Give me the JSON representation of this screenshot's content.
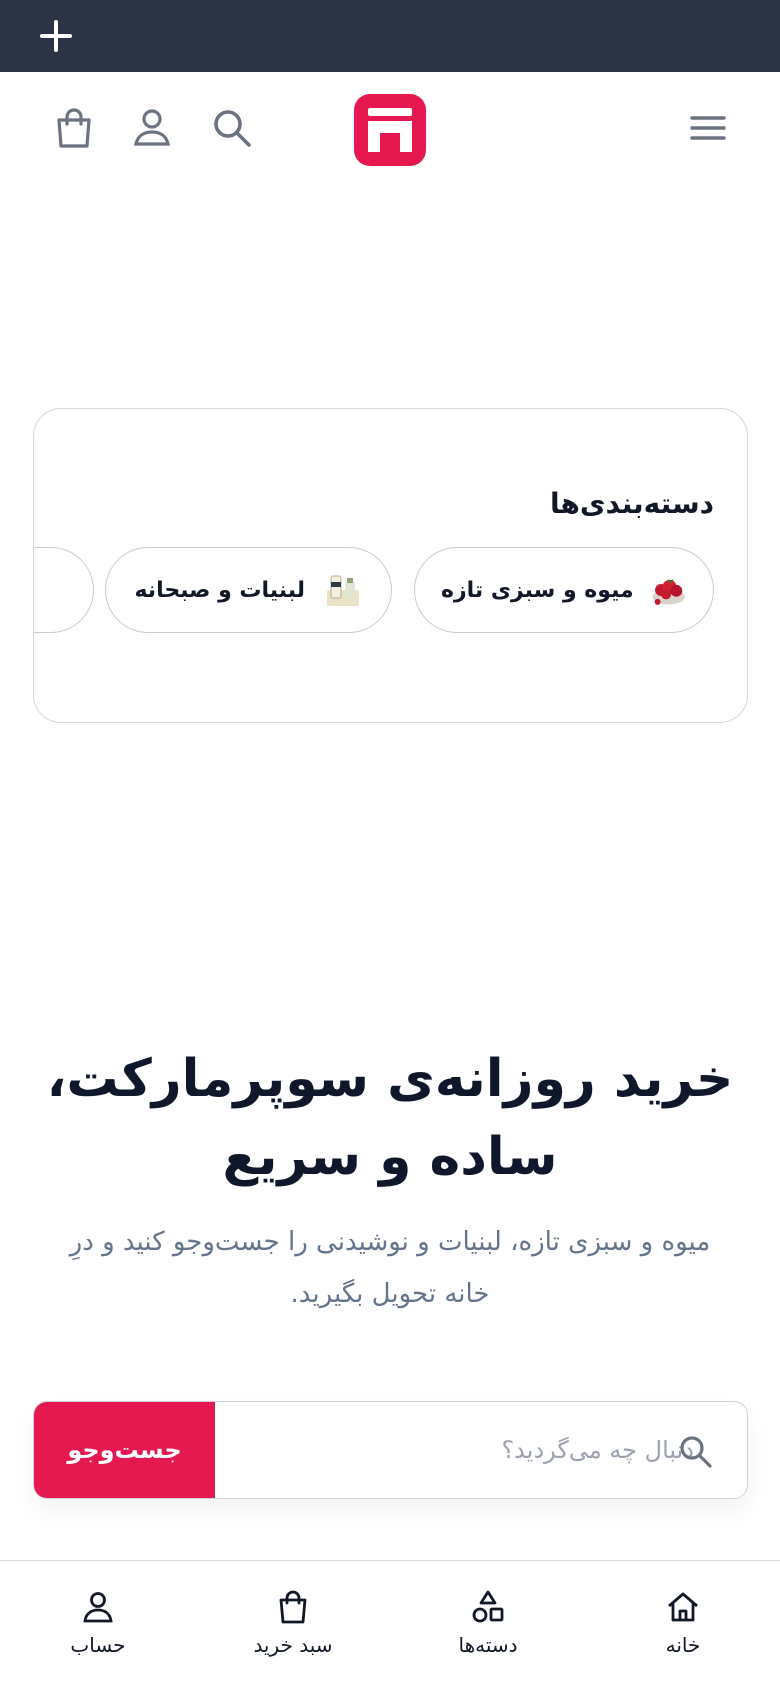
{
  "header": {
    "icons": [
      "menu-icon",
      "logo-icon",
      "search-icon",
      "user-icon",
      "shopping-bag-icon"
    ],
    "brand_color": "#e5194f"
  },
  "categories": {
    "title": "دسته‌بندی‌ها",
    "items": [
      {
        "label": "میوه و سبزی تازه",
        "icon": "strawberry-icon"
      },
      {
        "label": "لبنیات و صبحانه",
        "icon": "dairy-icon"
      }
    ]
  },
  "hero": {
    "title_line1": "خرید روزانه‌ی سوپرمارکت،",
    "title_line2": "ساده و سریع",
    "subtitle_line1": "میوه و سبزی تازه، لبنیات و نوشیدنی را جست‌وجو کنید و درِ",
    "subtitle_line2": "خانه تحویل بگیرید."
  },
  "search": {
    "placeholder": "دنبال چه می‌گردید؟",
    "button_label": "جست‌وجو"
  },
  "bottom_nav": {
    "items": [
      {
        "label": "خانه",
        "icon": "home-icon"
      },
      {
        "label": "دسته‌ها",
        "icon": "shapes-icon"
      },
      {
        "label": "سبد خرید",
        "icon": "shopping-bag-icon"
      },
      {
        "label": "حساب",
        "icon": "user-icon"
      }
    ]
  },
  "colors": {
    "top_bar": "#2b3345",
    "accent": "#e5194f",
    "muted_text": "#64748b"
  }
}
